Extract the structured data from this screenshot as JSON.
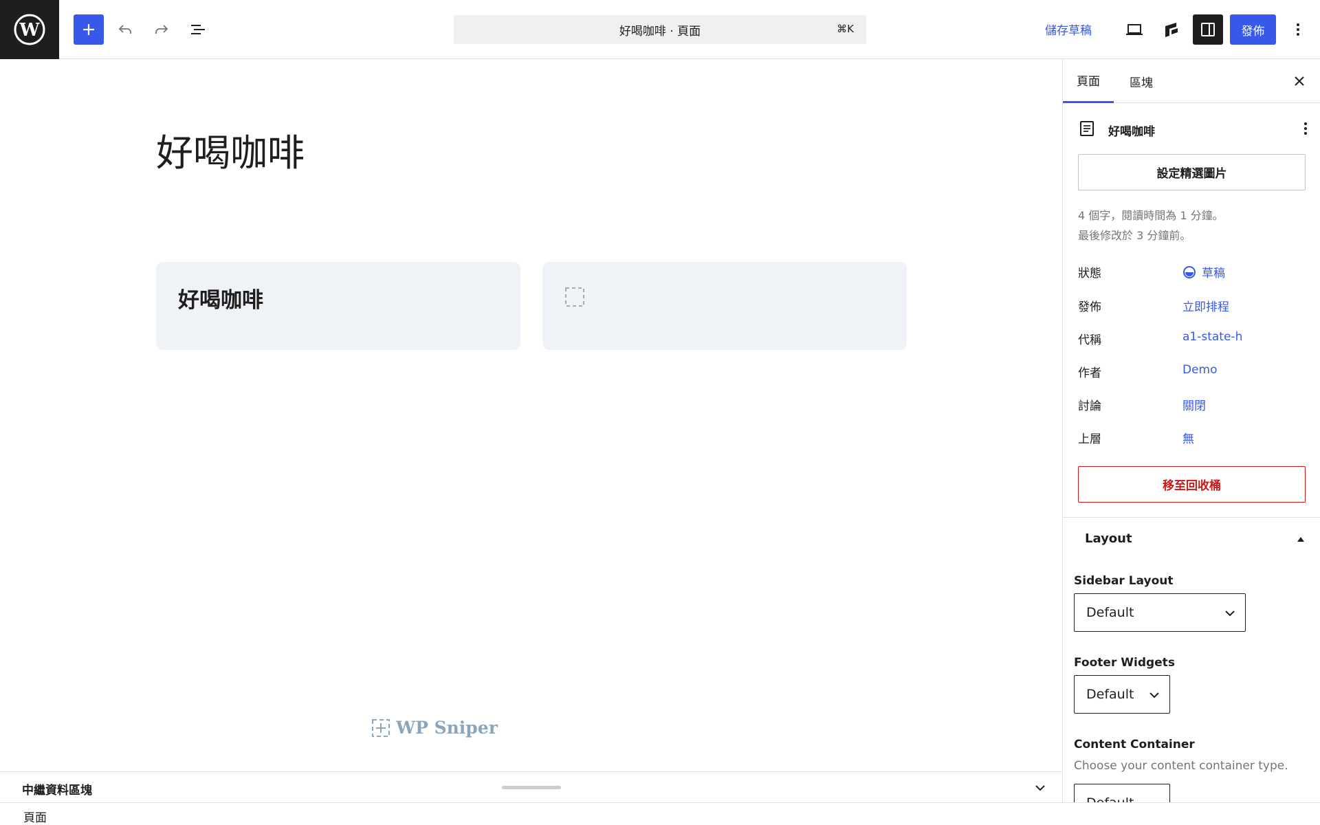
{
  "header": {
    "document_bar_title": "好喝咖啡 · 頁面",
    "document_bar_shortcut": "⌘K",
    "save_draft_label": "儲存草稿",
    "publish_label": "發佈",
    "accent_color": "#3858e9"
  },
  "canvas": {
    "page_title": "好喝咖啡",
    "card_left_heading": "好喝咖啡",
    "watermark": "WP Sniper"
  },
  "footer": {
    "meta_boxes_label": "中繼資料區塊",
    "breadcrumb": "頁面"
  },
  "sidebar": {
    "tabs": [
      {
        "label": "頁面",
        "active": true
      },
      {
        "label": "區塊",
        "active": false
      }
    ],
    "doc_title": "好喝咖啡",
    "featured_image_label": "設定精選圖片",
    "word_count": "4 個字，閱讀時間為 1 分鐘。",
    "last_modified": "最後修改於 3 分鐘前。",
    "fields": [
      {
        "label": "狀態",
        "value": "草稿"
      },
      {
        "label": "發佈",
        "value": "立即排程"
      },
      {
        "label": "代稱",
        "value": "a1-state-h"
      },
      {
        "label": "作者",
        "value": "Demo"
      },
      {
        "label": "討論",
        "value": "關閉"
      },
      {
        "label": "上層",
        "value": "無"
      }
    ],
    "trash_label": "移至回收桶",
    "trash_color": "#cc1818",
    "layout": {
      "heading": "Layout",
      "sidebar_layout_label": "Sidebar Layout",
      "sidebar_layout_value": "Default",
      "footer_widgets_label": "Footer Widgets",
      "footer_widgets_value": "Default",
      "content_container_label": "Content Container",
      "content_container_desc": "Choose your content container type.",
      "content_container_value": "Default"
    }
  }
}
